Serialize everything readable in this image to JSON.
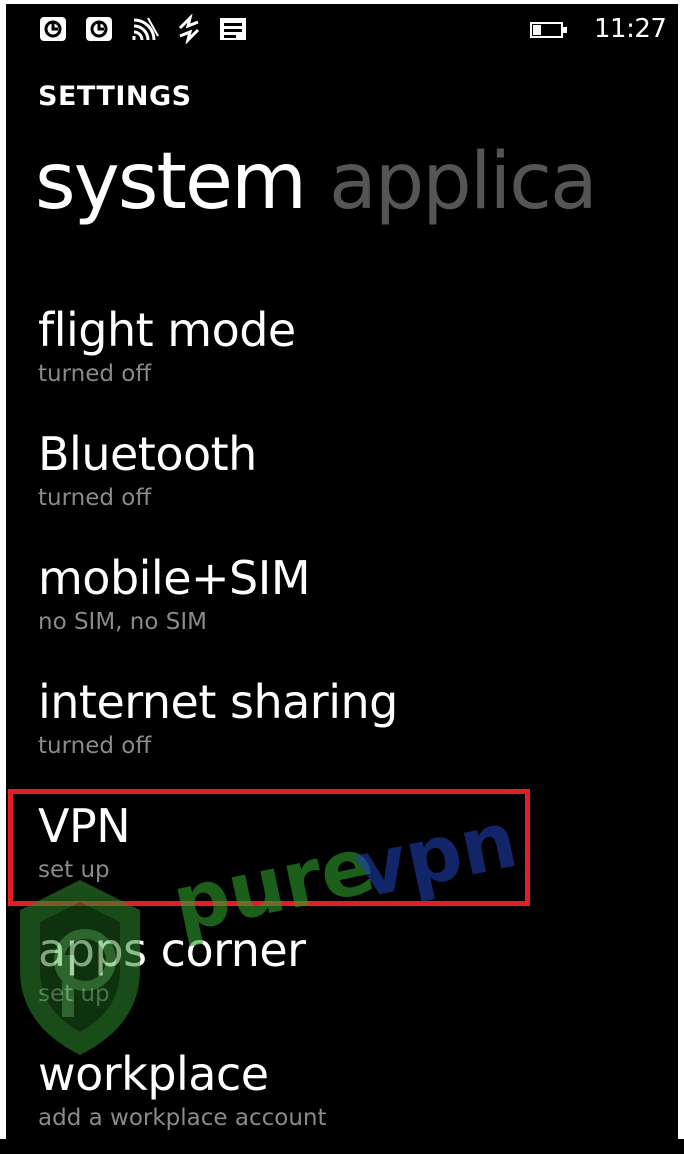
{
  "status_bar": {
    "icons": [
      "notification-icon",
      "notification-icon",
      "wifi-icon",
      "sync-icon",
      "message-icon",
      "battery-icon"
    ],
    "time": "11:27"
  },
  "header": {
    "app_title": "SETTINGS",
    "pivot_tabs": [
      "system",
      "applica"
    ]
  },
  "settings": [
    {
      "name": "flight mode",
      "status": "turned off"
    },
    {
      "name": "Bluetooth",
      "status": "turned off"
    },
    {
      "name": "mobile+SIM",
      "status": "no SIM, no SIM"
    },
    {
      "name": "internet sharing",
      "status": "turned off"
    },
    {
      "name": "VPN",
      "status": "set up"
    },
    {
      "name": "apps corner",
      "status": "set up"
    },
    {
      "name": "workplace",
      "status": "add a workplace account"
    }
  ],
  "highlight": {
    "color": "#e01e24",
    "target": "VPN"
  },
  "watermark": {
    "text": "purevpn",
    "colors": {
      "pure": "#2e9e2e",
      "vpn": "#1f3fae"
    }
  }
}
